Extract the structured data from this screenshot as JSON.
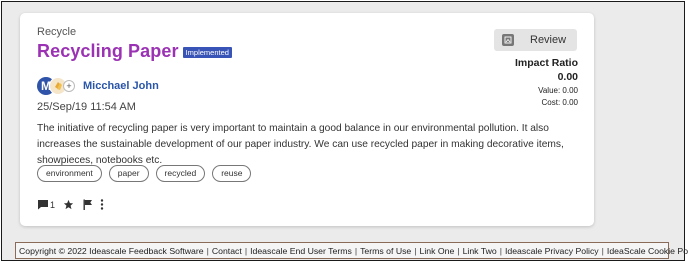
{
  "idea": {
    "category": "Recycle",
    "title": "Recycling Paper",
    "status": "Implemented",
    "author": {
      "initial": "M",
      "name": "Micchael John",
      "collaborator_icon": "clapping-hands-icon",
      "add_symbol": "+"
    },
    "timestamp": "25/Sep/19 11:54 AM",
    "description": "The initiative of recycling paper is very important to maintain a good balance in our environmental pollution. It also increases the sustainable development of our paper industry. We can use recycled paper in making decorative items, showpieces, notebooks etc.",
    "tags": [
      "environment",
      "paper",
      "recycled",
      "reuse"
    ],
    "comment_count": "1"
  },
  "review": {
    "label": "Review",
    "icon": "review-icon"
  },
  "impact": {
    "title": "Impact Ratio",
    "ratio": "0.00",
    "value": "Value: 0.00",
    "cost": "Cost: 0.00"
  },
  "footer": {
    "links": [
      "Copyright © 2022 Ideascale Feedback Software",
      "Contact",
      "Ideascale End User Terms",
      "Terms of Use",
      "Link One",
      "Link Two",
      "Ideascale Privacy Policy",
      "IdeaScale Cookie Policy"
    ]
  },
  "colors": {
    "title": "#9b32b4",
    "badge": "#3854b6",
    "author": "#2a55a8",
    "avatar": "#2f53a8"
  }
}
